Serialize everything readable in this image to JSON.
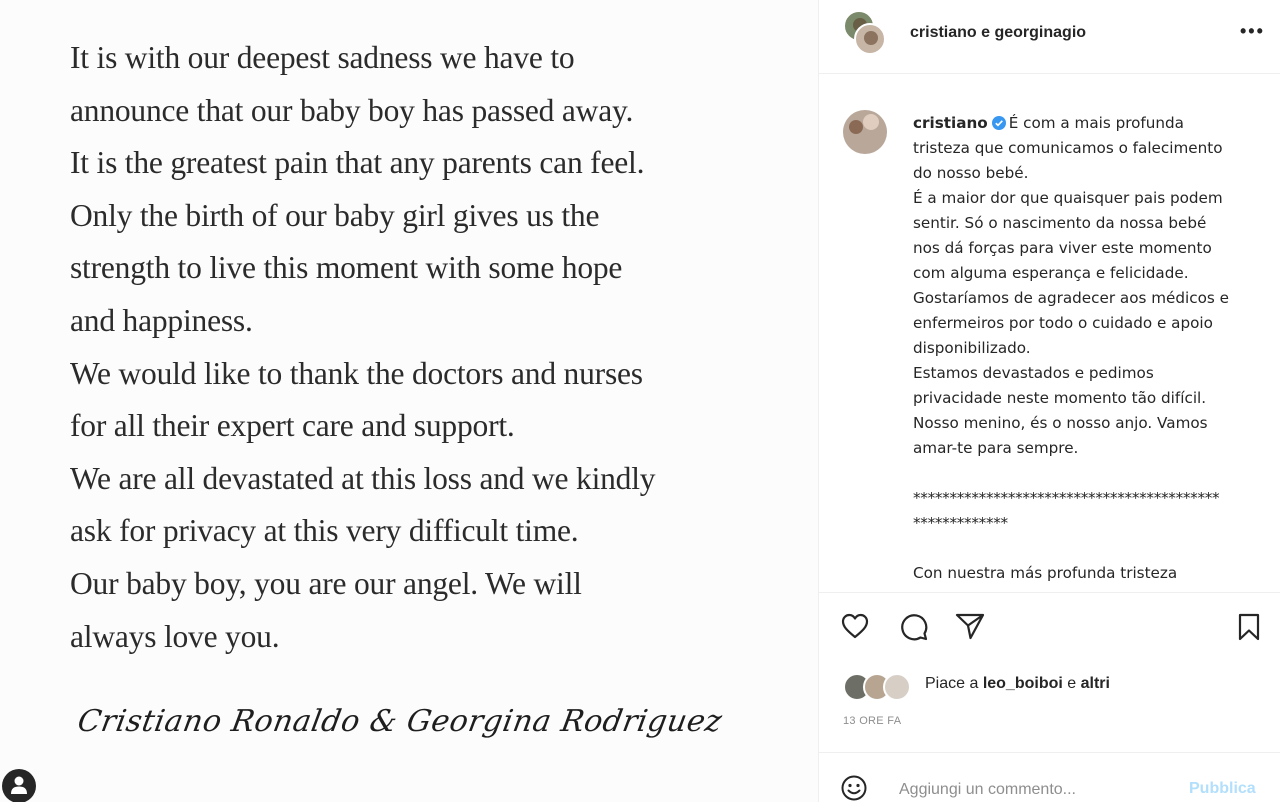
{
  "post_image": {
    "statement_lines": [
      "It is with our deepest sadness we have to",
      "announce that our baby boy has passed away.",
      "It is the greatest pain that any parents can feel.",
      "Only the birth of our baby girl gives us the",
      "strength to live this moment with some hope",
      "and happiness.",
      "We would like to thank the doctors and nurses",
      "for all their expert care and support.",
      "We are all devastated at this loss and we kindly",
      "ask for privacy at this very difficult time.",
      "Our baby boy, you are our angel. We will",
      "always love you."
    ],
    "signature": "Cristiano Ronaldo & Georgina Rodriguez"
  },
  "header": {
    "username": "cristiano e georginagio",
    "more_icon": "more-horizontal-icon"
  },
  "caption": {
    "username": "cristiano",
    "verified_color": "#3897f0",
    "lines": [
      "É com a mais profunda",
      "tristeza que comunicamos o falecimento",
      "do nosso bebé.",
      "É a maior dor que quaisquer pais podem",
      "sentir. Só o nascimento da nossa bebé",
      "nos dá forças para viver este momento",
      "com alguma esperança e felicidade.",
      "Gostaríamos de agradecer aos médicos e",
      "enfermeiros por todo o cuidado e apoio",
      "disponibilizado.",
      "Estamos devastados e pedimos",
      "privacidade neste momento tão difícil.",
      "Nosso menino, és o nosso anjo. Vamos",
      "amar-te para sempre."
    ],
    "stars_line_1": "******************************************",
    "stars_line_2": "*************",
    "spanish_line": "Con nuestra más profunda tristeza"
  },
  "actions": {
    "icons": [
      "heart-icon",
      "comment-icon",
      "share-icon",
      "bookmark-icon"
    ]
  },
  "likes": {
    "prefix": "Piace a ",
    "user": "leo_boiboi",
    "connector": " e ",
    "others": "altri"
  },
  "timestamp": "13 ORE FA",
  "comment": {
    "placeholder": "Aggiungi un commento...",
    "publish_label": "Pubblica",
    "publish_color": "#b2dffc"
  }
}
